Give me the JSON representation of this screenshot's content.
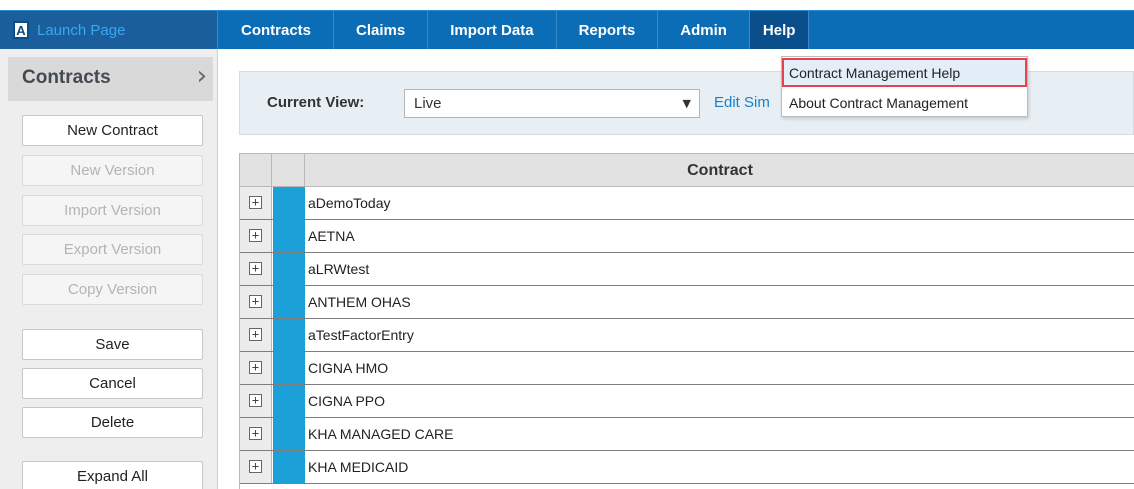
{
  "topnav": {
    "launch_logo": "A",
    "launch_label": "Launch Page",
    "items": [
      "Contracts",
      "Claims",
      "Import Data",
      "Reports",
      "Admin",
      "Help"
    ]
  },
  "sidebar": {
    "title": "Contracts",
    "chevron": "›",
    "buttons": [
      {
        "label": "New Contract",
        "enabled": true
      },
      {
        "label": "New Version",
        "enabled": false
      },
      {
        "label": "Import Version",
        "enabled": false
      },
      {
        "label": "Export Version",
        "enabled": false
      },
      {
        "label": "Copy Version",
        "enabled": false
      },
      {
        "label": "Save",
        "enabled": true
      },
      {
        "label": "Cancel",
        "enabled": true
      },
      {
        "label": "Delete",
        "enabled": true
      },
      {
        "label": "Expand All",
        "enabled": true
      }
    ]
  },
  "view": {
    "label": "Current View:",
    "selected": "Live",
    "edit_link": "Edit Sim"
  },
  "help_menu": {
    "items": [
      "Contract Management Help",
      "About Contract Management"
    ],
    "highlighted_index": 0
  },
  "grid": {
    "header": "Contract",
    "rows": [
      "aDemoToday",
      "AETNA",
      "aLRWtest",
      "ANTHEM OHAS",
      "aTestFactorEntry",
      "CIGNA HMO",
      "CIGNA PPO",
      "KHA MANAGED CARE",
      "KHA MEDICAID"
    ]
  },
  "colors": {
    "nav_bg": "#0a6db5",
    "nav_active": "#0a4f8c",
    "row_marker": "#1ba0d8",
    "highlight_border": "#e8414f"
  }
}
